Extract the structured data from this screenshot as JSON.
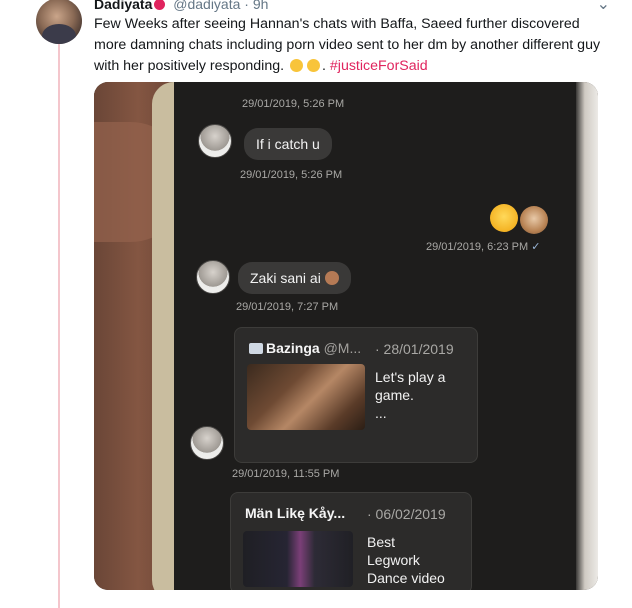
{
  "tweet": {
    "display_name": "Dadiyata",
    "handle": "@dadiyata",
    "separator": "·",
    "time": "9h",
    "text": "Few Weeks after seeing Hannan's  chats with Baffa, Saeed further  discovered more damning chats including porn video sent to her dm by another different guy with her positively responding.",
    "hashtag": "#justiceForSaid",
    "hashtag_color": "#e0245e"
  },
  "photo": {
    "chat": {
      "ts_top": "29/01/2019, 5:26 PM",
      "msg_1": "If i catch u",
      "ts_1": "29/01/2019, 5:26 PM",
      "ts_2": "29/01/2019, 6:23 PM",
      "msg_3": "Zaki sani ai",
      "ts_3": "29/01/2019, 7:27 PM",
      "card_1": {
        "name": "Bazinga",
        "handle": "@M...",
        "date": "· 28/01/2019",
        "text_line1": "Let's play a",
        "text_line2": "game.",
        "text_line3": "..."
      },
      "ts_4": "29/01/2019, 11:55 PM",
      "card_2": {
        "name": "Män Likę Kåy...",
        "date": "· 06/02/2019",
        "text_line1": "Best",
        "text_line2": "Legwork",
        "text_line3": "Dance video"
      }
    }
  },
  "icons": {
    "more": "chevron-down-icon",
    "verified": "red-circle-icon"
  }
}
